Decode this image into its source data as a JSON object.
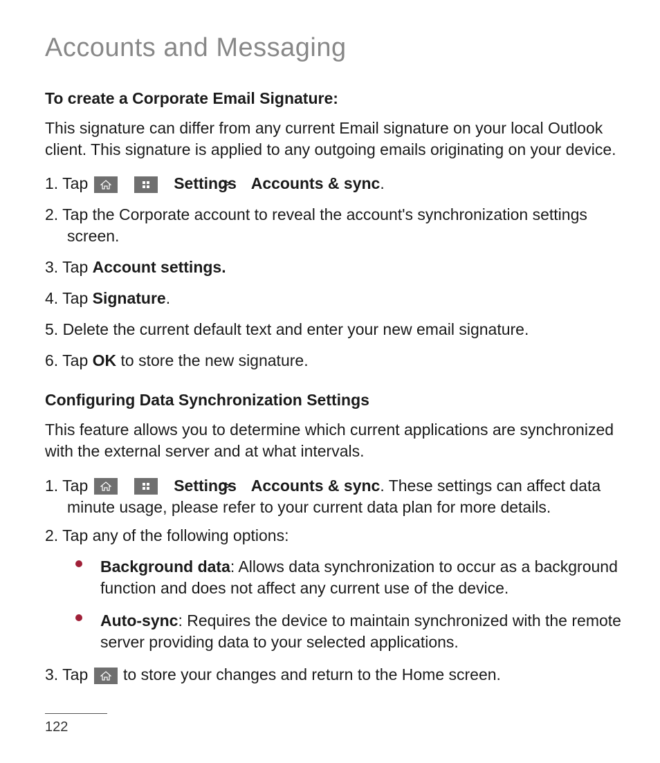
{
  "pageTitle": "Accounts and Messaging",
  "section1": {
    "heading": "To create a Corporate Email Signature:",
    "intro": "This signature can differ from any current Email signature on your local Outlook client. This signature is applied to any outgoing emails originating on your device.",
    "steps": {
      "s1": {
        "n": "1. Tap ",
        "settings": "Settings",
        "accounts": "Accounts & sync",
        "end": "."
      },
      "s2": "2. Tap the Corporate account to reveal the account's synchronization settings screen.",
      "s3": {
        "pre": "3. Tap ",
        "bold": "Account settings."
      },
      "s4": {
        "pre": "4. Tap ",
        "bold": "Signature",
        "post": "."
      },
      "s5": "5. Delete the current default text and enter your new email signature.",
      "s6": {
        "pre": "6. Tap ",
        "bold": "OK",
        "post": " to store the new signature."
      }
    }
  },
  "section2": {
    "heading": "Configuring Data Synchronization Settings",
    "intro": "This feature allows you to determine which current applications are synchronized with the external server and at what intervals.",
    "steps": {
      "s1": {
        "n": "1. Tap ",
        "settings": "Settings",
        "accounts": "Accounts & sync",
        "post": ". These settings can affect data ",
        "cont": "minute usage, please refer to your current data plan for more details."
      },
      "s2": "2. Tap any of the following options:",
      "bullets": {
        "b1": {
          "bold": "Background data",
          "rest": ": Allows data synchronization to occur as a background function and does not affect any current use of the device."
        },
        "b2": {
          "bold": "Auto-sync",
          "rest": ": Requires the device to maintain synchronized with the remote server providing data to your selected applications."
        }
      },
      "s3": {
        "pre": "3. Tap ",
        "post": " to store your changes and return to the Home screen."
      }
    }
  },
  "separators": {
    "gt": ">"
  },
  "pageNumber": "122"
}
